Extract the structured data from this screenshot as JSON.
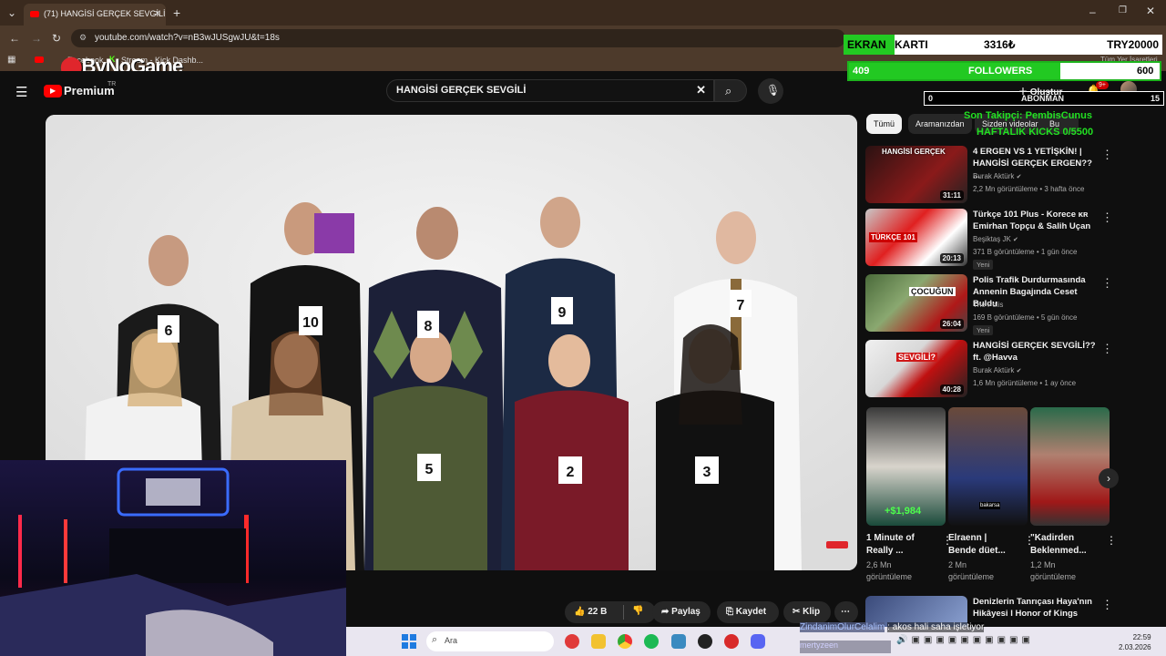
{
  "browser": {
    "tab_title": "(71) HANGİSİ GERÇEK SEVGİLİ...",
    "url": "youtube.com/watch?v=nB3wJUSgwJU&t=18s",
    "bookmarks": [
      "Facebook",
      "Stream - Kick Dashb..."
    ],
    "bookmarks_right": "Tüm Yer İşaretleri",
    "logo_overlay": "ByNoGame"
  },
  "youtube": {
    "logo": "Premium",
    "region": "TR",
    "search_value": "HANGİSİ GERÇEK SEVGİLİ",
    "create_label": "Oluştur",
    "notif_count": "9+",
    "filter_chips": [
      "Tümü",
      "Aramanızdan",
      "Sizden videolar",
      "Bu"
    ],
    "actions": {
      "likes": "22 B",
      "share": "Paylaş",
      "save": "Kaydet",
      "clip": "Klip"
    },
    "video_numbers": [
      "6",
      "10",
      "8",
      "9",
      "7",
      "5",
      "2",
      "3"
    ],
    "recommendations": [
      {
        "title": "4 ERGEN VS 1 YETİŞKİN! | HANGİSİ GERÇEK ERGEN?? ...",
        "channel": "Burak Aktürk",
        "meta": "2,2 Mn görüntüleme • 3 hafta önce",
        "duration": "31:11",
        "badge": "",
        "thumb_text": "HANGİSİ GERÇEK"
      },
      {
        "title": "Türkçe 101 Plus - Korece ᴋʀ Emirhan Topçu & Salih Uçan",
        "channel": "Beşiktaş JK",
        "meta": "371 B görüntüleme • 1 gün önce",
        "duration": "20:13",
        "badge": "Yeni",
        "thumb_text": "TÜRKÇE 101"
      },
      {
        "title": "Polis Trafik Durdurmasında Annenin Bagajında Ceset Buldu",
        "channel": "The Polis",
        "meta": "169 B görüntüleme • 5 gün önce",
        "duration": "26:04",
        "badge": "Yeni",
        "thumb_text": "ÇOCUĞUN"
      },
      {
        "title": "HANGİSİ GERÇEK SEVGİLİ?? ft. @Havva",
        "channel": "Burak Aktürk",
        "meta": "1,6 Mn görüntüleme • 1 ay önce",
        "duration": "40:28",
        "badge": "",
        "thumb_text": "SEVGİLİ?"
      }
    ],
    "shorts": [
      {
        "title": "1 Minute of Really ...",
        "views": "2,6 Mn",
        "views_suffix": "görüntüleme",
        "overlay": "+$1,984"
      },
      {
        "title": "Elraenn | Bende düet...",
        "views": "2 Mn",
        "views_suffix": "görüntüleme",
        "overlay": "bakarsa"
      },
      {
        "title": "\"Kadirden Beklenmed...",
        "views": "1,2 Mn",
        "views_suffix": "görüntüleme",
        "overlay": ""
      }
    ],
    "next_rec": {
      "title": "Denizlerin Tanrıçası Haya'nın Hikâyesi l Honor of Kings"
    }
  },
  "stream_overlay": {
    "ekran_label_green": "EKRAN",
    "ekran_label_rest": "KARTI",
    "ekran_price": "3316₺",
    "ekran_goal": "TRY20000",
    "followers_current": "409",
    "followers_label": "FOLLOWERS",
    "followers_goal": "600",
    "followers_progress": 0.68,
    "abonman_left": "0",
    "abonman_label": "ABONMAN",
    "abonman_right": "15",
    "last_follower": "Son Takipçi: PembisCunus",
    "weekly_kicks": "HAFTALIK KICKS 0/5500",
    "chat_user": "ZindanimOlurCelalim",
    "chat_msg": ": akos hali saha işletiyor",
    "chat_user2": "mertyzeen"
  },
  "taskbar": {
    "search_placeholder": "Ara",
    "time": "22:59",
    "date": "2.03.2026"
  }
}
